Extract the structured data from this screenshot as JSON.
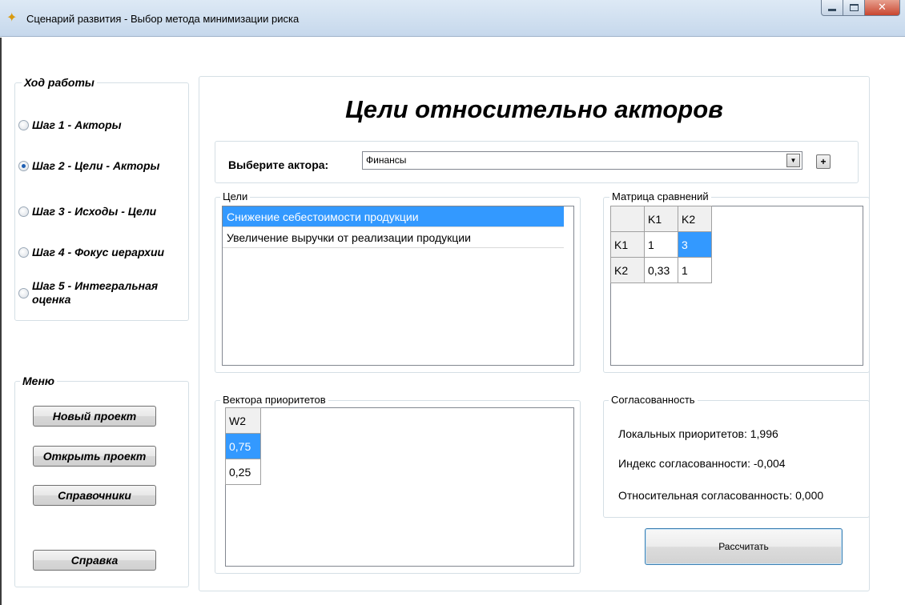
{
  "window": {
    "title": "Сценарий развития - Выбор метода минимизации риска",
    "close_glyph": "✕"
  },
  "sidebar": {
    "progress_title": "Ход работы",
    "steps": [
      {
        "label": "Шаг 1 - Акторы",
        "checked": false
      },
      {
        "label": "Шаг 2 - Цели - Акторы",
        "checked": true
      },
      {
        "label": "Шаг 3 - Исходы - Цели",
        "checked": false
      },
      {
        "label": "Шаг 4 - Фокус иерархии",
        "checked": false
      },
      {
        "label": "Шаг 5 - Интегральная оценка",
        "checked": false
      }
    ],
    "menu_title": "Меню",
    "menu": {
      "new_project": "Новый проект",
      "open_project": "Открыть проект",
      "references": "Справочники",
      "help": "Справка"
    }
  },
  "main": {
    "title": "Цели относительно акторов",
    "actor_label": "Выберите актора:",
    "actor_value": "Финансы",
    "plus_label": "+",
    "goals_title": "Цели",
    "goals": [
      {
        "label": "Снижение себестоимости продукции",
        "selected": true
      },
      {
        "label": "Увеличение выручки от реализации продукции",
        "selected": false
      }
    ],
    "matrix_title": "Матрица сравнений",
    "matrix": {
      "columns": [
        "K1",
        "K2"
      ],
      "rows": [
        {
          "name": "K1",
          "cells": [
            "1",
            "3"
          ]
        },
        {
          "name": "K2",
          "cells": [
            "0,33",
            "1"
          ]
        }
      ]
    },
    "vectors_title": "Вектора приоритетов",
    "vectors": {
      "header": "W2",
      "values": [
        "0,75",
        "0,25"
      ]
    },
    "consistency_title": "Согласованность",
    "consistency": {
      "local": "Локальных приоритетов: 1,996",
      "index": "Индекс согласованности: -0,004",
      "relative": "Относительная согласованность: 0,000"
    },
    "calculate_label": "Рассчитать"
  },
  "colors": {
    "selection": "#3399ff",
    "titlebar": "#c6d8ec",
    "group_border": "#d5dfe5"
  }
}
